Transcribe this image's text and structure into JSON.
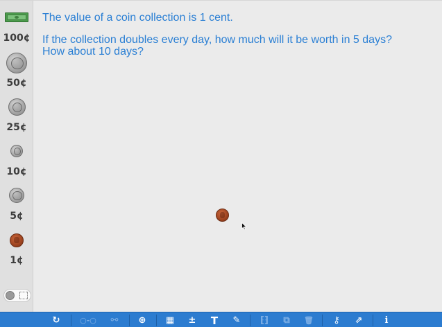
{
  "sidebar": {
    "denominations": [
      "100¢",
      "50¢",
      "25¢",
      "10¢",
      "5¢",
      "1¢"
    ],
    "coin_icons": [
      "dollar-bill-icon",
      "half-dollar-icon",
      "quarter-icon",
      "dime-icon",
      "nickel-icon",
      "penny-icon"
    ]
  },
  "prompt": {
    "line1": "The value of a coin collection is 1 cent.",
    "line2": "If the collection doubles every day, how much will it be worth in 5 days?",
    "line3": "How about 10 days?"
  },
  "toolbar": {
    "icons": {
      "refresh": "↻",
      "connect": "○-○",
      "ring": "⚯",
      "zoom": "⊕",
      "panel": "▦",
      "calc": "±",
      "text": "T",
      "pen": "✎",
      "group": "⁅⁆",
      "duplicate": "⧉",
      "trash": "🗑",
      "key": "⚷",
      "share": "⇗",
      "info": "i"
    }
  },
  "colors": {
    "prompt_text": "#2a7fd4",
    "toolbar_bg": "#2c7cd0",
    "copper": "#9e4420",
    "bill": "#4b9a4c"
  }
}
